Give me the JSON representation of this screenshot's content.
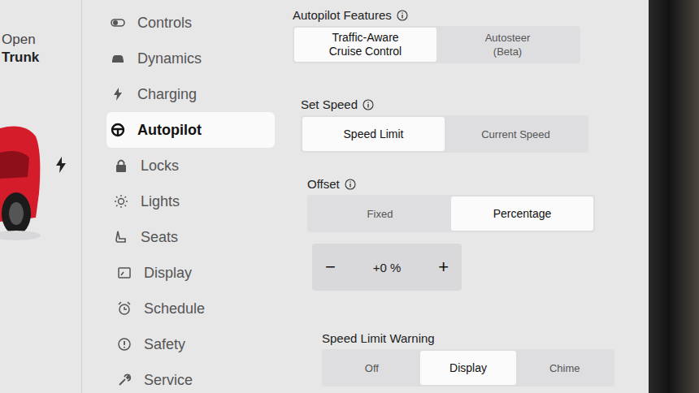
{
  "car_panel": {
    "labels": [
      "Open",
      "Trunk"
    ]
  },
  "sidebar": {
    "items": [
      {
        "label": "Controls",
        "selected": false
      },
      {
        "label": "Dynamics",
        "selected": false
      },
      {
        "label": "Charging",
        "selected": false
      },
      {
        "label": "Autopilot",
        "selected": true
      },
      {
        "label": "Locks",
        "selected": false
      },
      {
        "label": "Lights",
        "selected": false
      },
      {
        "label": "Seats",
        "selected": false
      },
      {
        "label": "Display",
        "selected": false
      },
      {
        "label": "Schedule",
        "selected": false
      },
      {
        "label": "Safety",
        "selected": false
      },
      {
        "label": "Service",
        "selected": false
      }
    ]
  },
  "sections": [
    {
      "kind": "segmented",
      "title": "Autopilot Features",
      "info": true,
      "options": [
        {
          "lines": [
            "Traffic-Aware",
            "Cruise Control"
          ],
          "selected": true
        },
        {
          "lines": [
            "Autosteer",
            "(Beta)"
          ],
          "selected": false
        }
      ]
    },
    {
      "kind": "segmented",
      "title": "Set Speed",
      "info": true,
      "options": [
        {
          "lines": [
            "Speed Limit"
          ],
          "selected": true
        },
        {
          "lines": [
            "Current Speed"
          ],
          "selected": false
        }
      ]
    },
    {
      "kind": "segmented",
      "title": "Offset",
      "info": true,
      "options": [
        {
          "lines": [
            "Fixed"
          ],
          "selected": false
        },
        {
          "lines": [
            "Percentage"
          ],
          "selected": true
        }
      ]
    },
    {
      "kind": "stepper",
      "minus": "−",
      "value": "+0 %",
      "plus": "+"
    },
    {
      "kind": "segmented",
      "title": "Speed Limit Warning",
      "info": false,
      "options": [
        {
          "lines": [
            "Off"
          ],
          "selected": false
        },
        {
          "lines": [
            "Display"
          ],
          "selected": true
        },
        {
          "lines": [
            "Chime"
          ],
          "selected": false
        }
      ]
    }
  ]
}
